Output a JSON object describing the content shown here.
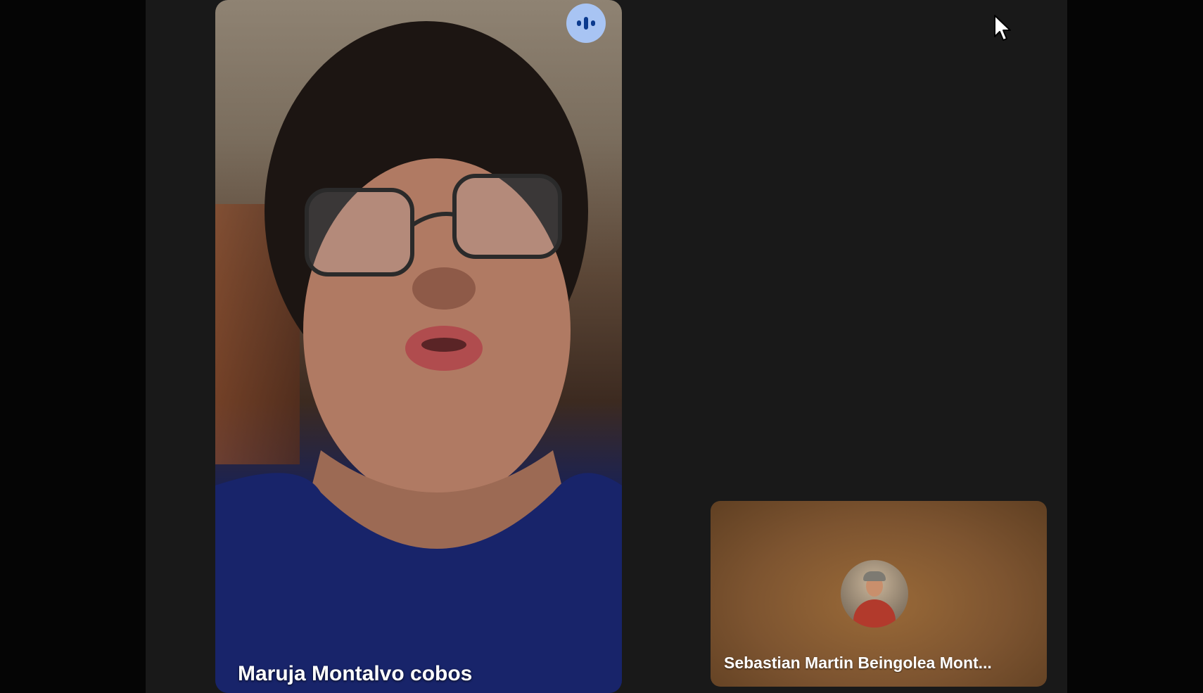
{
  "meeting": {
    "participants": [
      {
        "name": "Maruja Montalvo cobos",
        "speaking": true
      },
      {
        "name": "Sebastian Martin Beingolea Mont..."
      }
    ]
  },
  "icons": {
    "speaking": "audio-level-icon",
    "cursor": "mouse-pointer-icon"
  },
  "colors": {
    "stage_background": "#191919",
    "outer_background": "#050505",
    "speaking_indicator": "#a8c4f3",
    "speaking_indicator_bars": "#0b3a8e",
    "name_text": "#ffffff"
  }
}
